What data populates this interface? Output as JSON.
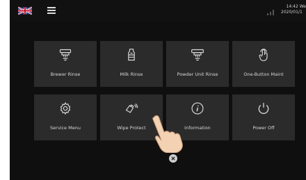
{
  "status": {
    "time": "14:42 We",
    "date": "2020/01/1"
  },
  "tiles": [
    {
      "label": "Brewer Rinse",
      "icon": "brewer-rinse-icon"
    },
    {
      "label": "Milk Rinse",
      "icon": "milk-rinse-icon"
    },
    {
      "label": "Powder Unit Rinse",
      "icon": "powder-unit-rinse-icon"
    },
    {
      "label": "One-Button Maint",
      "icon": "touch-icon"
    },
    {
      "label": "Service Menu",
      "icon": "gear-icon"
    },
    {
      "label": "Wipe Protect",
      "icon": "wipe-icon"
    },
    {
      "label": "Information",
      "icon": "info-icon"
    },
    {
      "label": "Power Off",
      "icon": "power-icon"
    }
  ],
  "colors": {
    "background": "#0f0f0f",
    "tile": "#2b2b2b",
    "text": "#d8d8d8"
  }
}
